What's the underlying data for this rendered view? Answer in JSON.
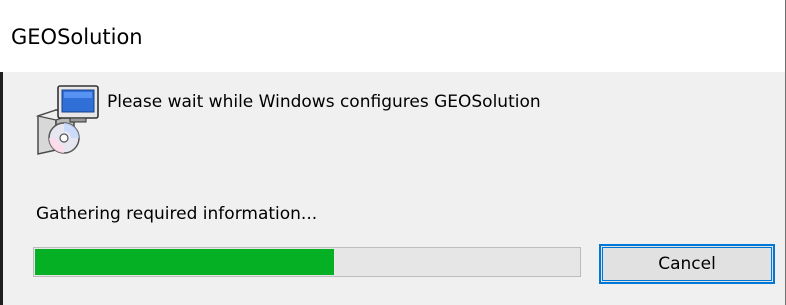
{
  "window": {
    "title": "GEOSolution"
  },
  "content": {
    "message": "Please wait while Windows configures GEOSolution",
    "status": "Gathering required information...",
    "icon": "installer-box-cd-icon"
  },
  "progress": {
    "value_percent": 55,
    "fill_color": "#06b025",
    "track_color": "#e6e6e6"
  },
  "buttons": {
    "cancel_label": "Cancel"
  },
  "colors": {
    "accent": "#0078d7",
    "window_bg": "#f0f0f0",
    "title_bg": "#ffffff"
  }
}
